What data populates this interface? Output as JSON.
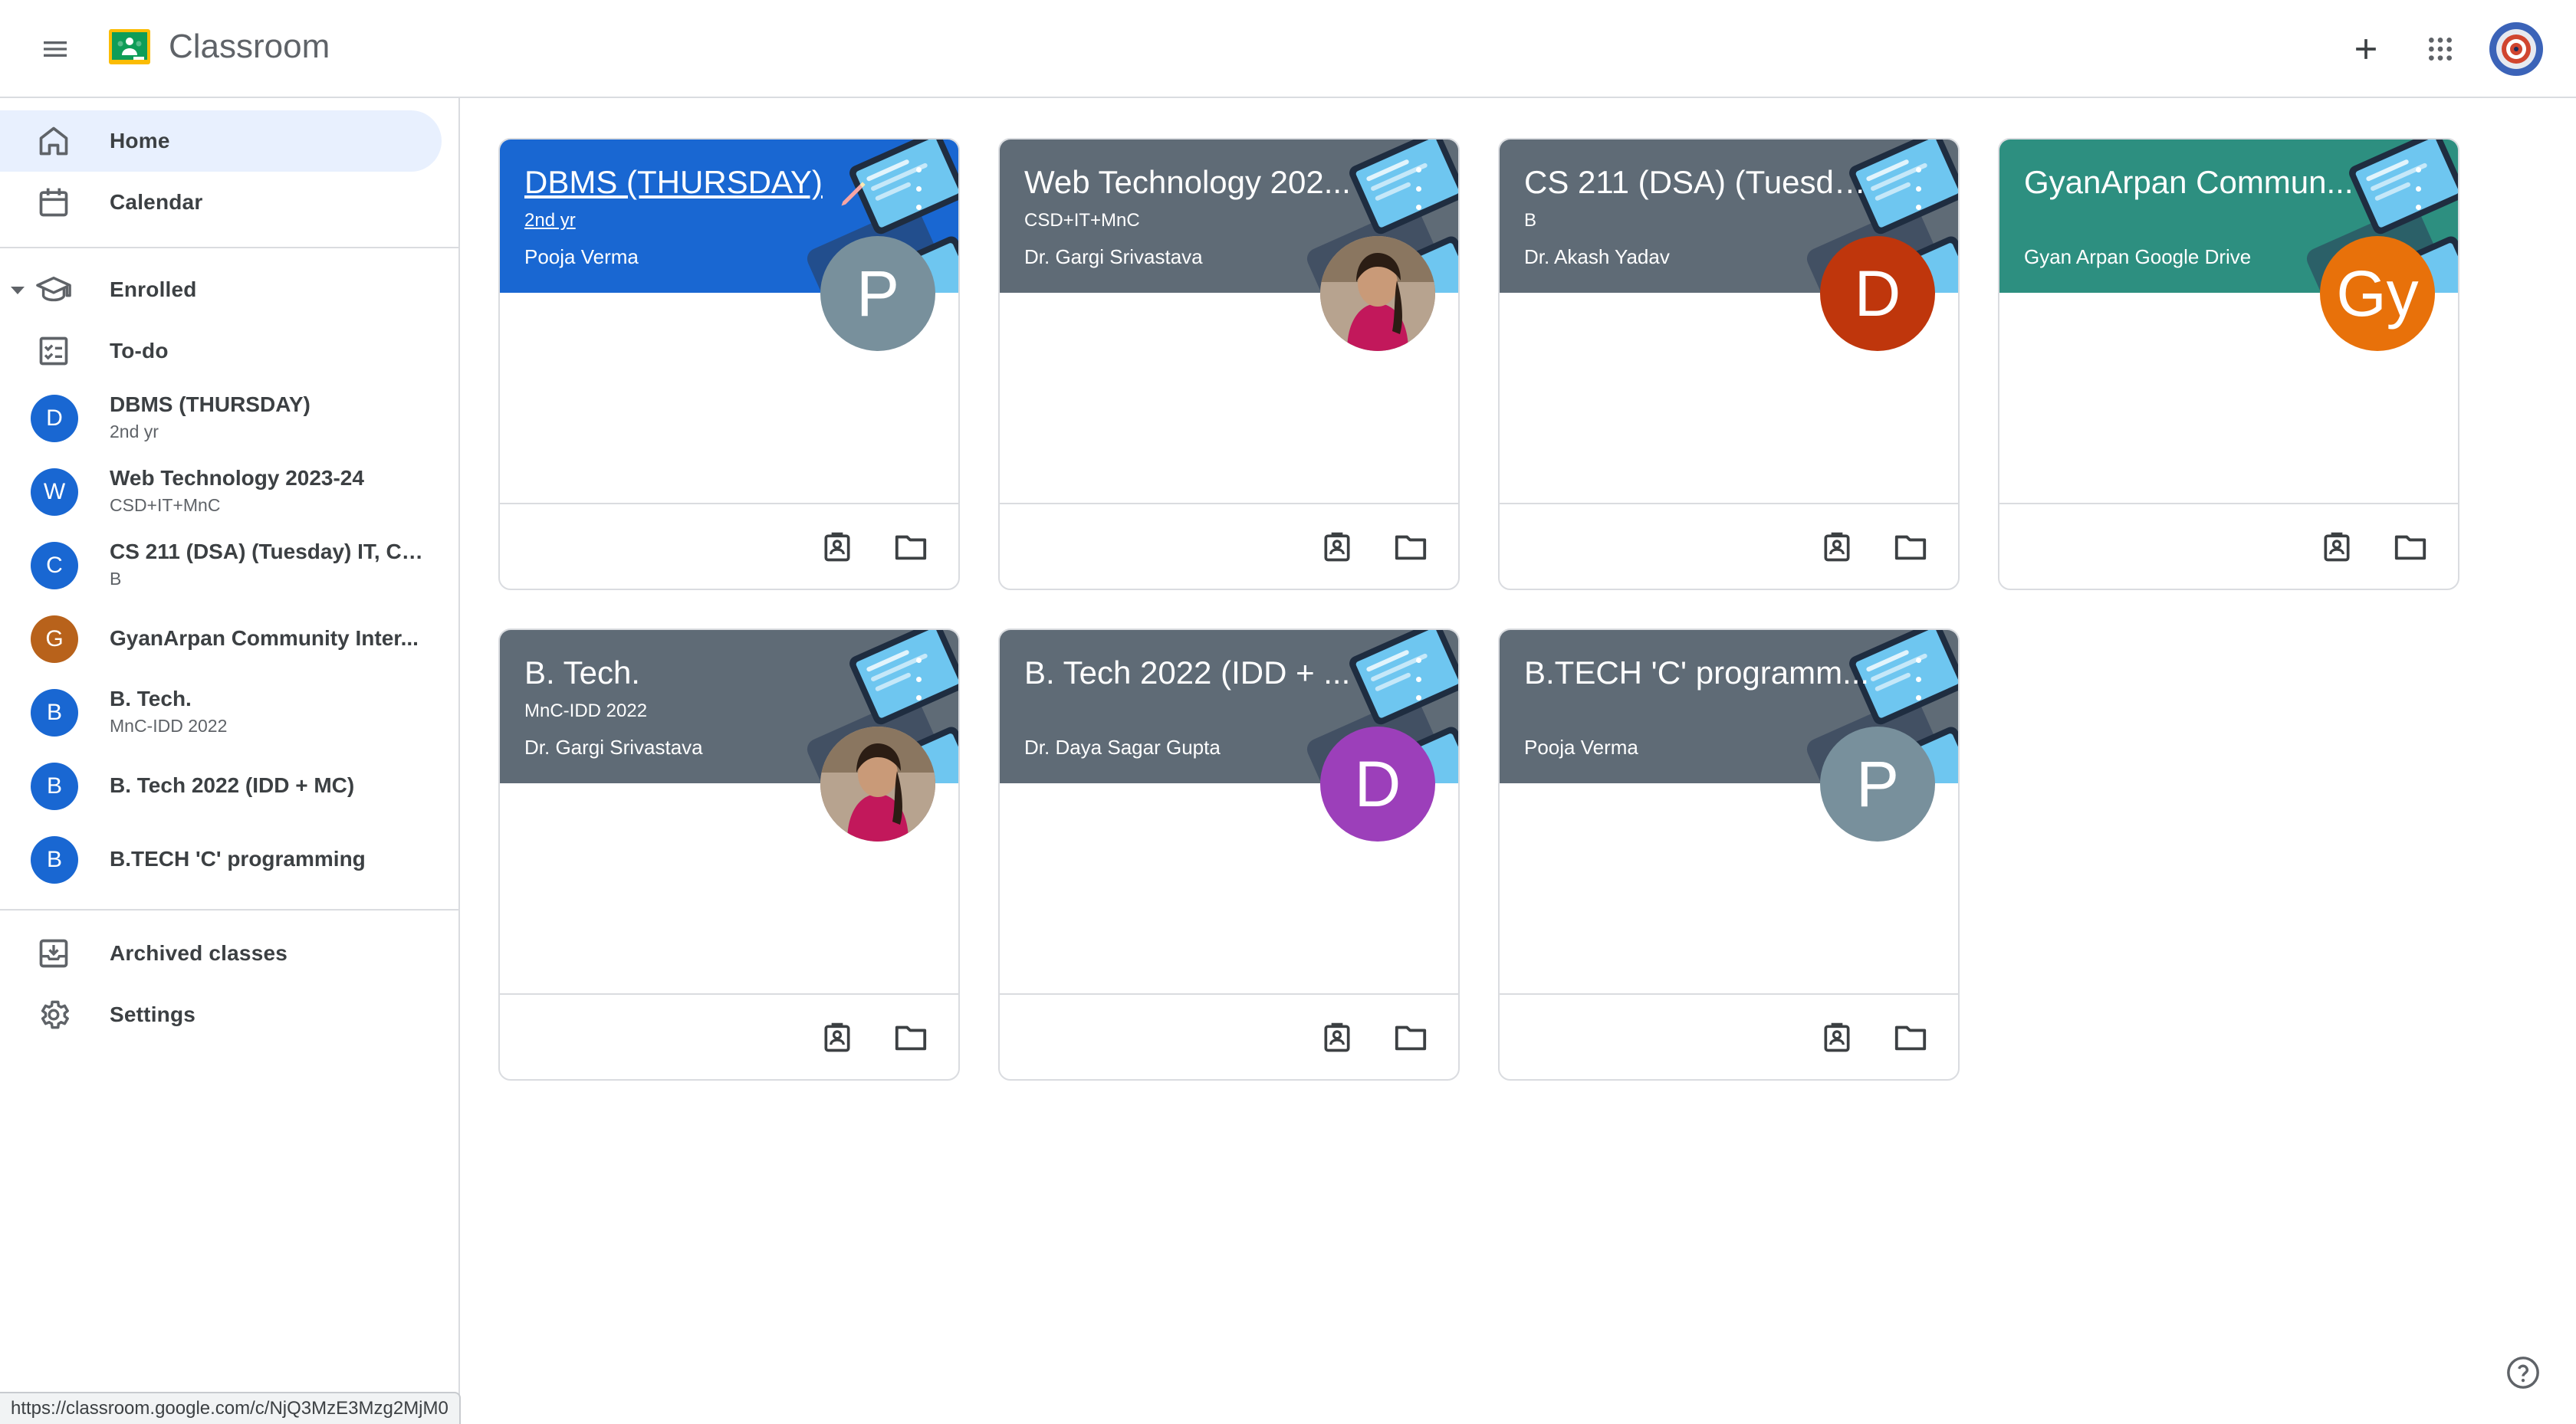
{
  "header": {
    "app_title": "Classroom",
    "icons": [
      "main-menu-icon",
      "classroom-logo",
      "plus-icon",
      "apps-grid-icon",
      "account-avatar"
    ]
  },
  "sidebar": {
    "home": "Home",
    "calendar": "Calendar",
    "enrolled": "Enrolled",
    "todo": "To-do",
    "classes": [
      {
        "initial": "D",
        "name": "DBMS (THURSDAY)",
        "sub": "2nd yr",
        "color": "#1967d2"
      },
      {
        "initial": "W",
        "name": "Web Technology 2023-24",
        "sub": "CSD+IT+MnC",
        "color": "#1967d2"
      },
      {
        "initial": "C",
        "name": "CS 211 (DSA) (Tuesday) IT, CS...",
        "sub": "B",
        "color": "#1967d2"
      },
      {
        "initial": "G",
        "name": "GyanArpan Community Inter...",
        "sub": "",
        "color": "#b8621b"
      },
      {
        "initial": "B",
        "name": "B. Tech.",
        "sub": "MnC-IDD 2022",
        "color": "#1967d2"
      },
      {
        "initial": "B",
        "name": "B. Tech 2022 (IDD + MC)",
        "sub": "",
        "color": "#1967d2"
      },
      {
        "initial": "B",
        "name": "B.TECH 'C' programming",
        "sub": "",
        "color": "#1967d2"
      }
    ],
    "archived": "Archived classes",
    "settings": "Settings"
  },
  "cards": [
    {
      "title": "DBMS (THURSDAY)",
      "section": "2nd yr",
      "teacher": "Pooja Verma",
      "avatar_text": "P",
      "avatar_color": "#78909c",
      "header_color": "#1967d2",
      "avatar_photo": false
    },
    {
      "title": "Web Technology 202...",
      "section": "CSD+IT+MnC",
      "teacher": "Dr. Gargi Srivastava",
      "avatar_text": "",
      "avatar_color": "#8d6e63",
      "header_color": "#5f6b76",
      "avatar_photo": true
    },
    {
      "title": "CS 211 (DSA) (Tuesda...",
      "section": "B",
      "teacher": "Dr. Akash Yadav",
      "avatar_text": "D",
      "avatar_color": "#bf360c",
      "header_color": "#5f6b76",
      "avatar_photo": false
    },
    {
      "title": "GyanArpan Commun...",
      "section": "",
      "teacher": "Gyan Arpan Google Drive",
      "avatar_text": "Gy",
      "avatar_color": "#e8710a",
      "header_color": "#2d8f80",
      "avatar_photo": false
    },
    {
      "title": "B. Tech.",
      "section": "MnC-IDD 2022",
      "teacher": "Dr. Gargi Srivastava",
      "avatar_text": "",
      "avatar_color": "#8d6e63",
      "header_color": "#5f6b76",
      "avatar_photo": true
    },
    {
      "title": "B. Tech 2022 (IDD + ...",
      "section": "",
      "teacher": "Dr. Daya Sagar Gupta",
      "avatar_text": "D",
      "avatar_color": "#9c3fba",
      "header_color": "#5f6b76",
      "avatar_photo": false
    },
    {
      "title": "B.TECH 'C' programm...",
      "section": "",
      "teacher": "Pooja Verma",
      "avatar_text": "P",
      "avatar_color": "#78909c",
      "header_color": "#5f6b76",
      "avatar_photo": false
    }
  ],
  "status_bar_url": "https://classroom.google.com/c/NjQ3MzE3Mzg2MjM0"
}
